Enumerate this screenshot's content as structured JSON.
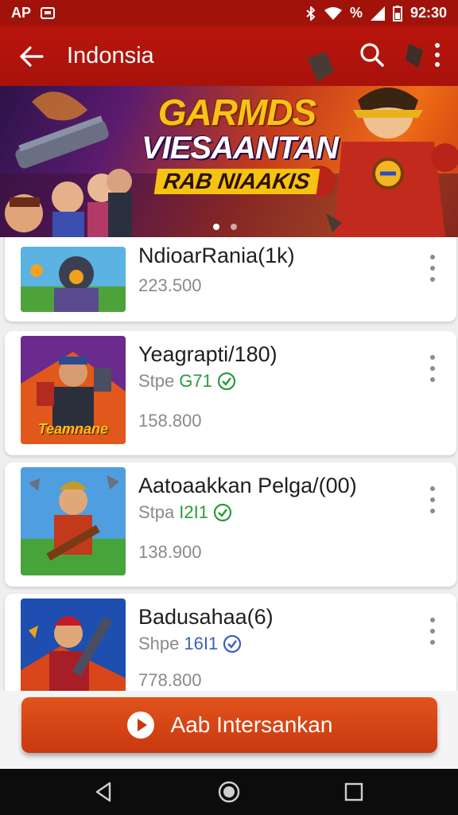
{
  "status": {
    "carrier": "AP",
    "signal_pct": "%",
    "time": "92:30"
  },
  "app_bar": {
    "title": "Indonsia"
  },
  "banner": {
    "line1": "GARMDS",
    "line2": "VIESAANTAN",
    "line3": "RAB NIAAKIS",
    "slide_count": 2,
    "active_slide": 1
  },
  "items": [
    {
      "title": "NdioarRania(1k)",
      "subtitle": "",
      "subtitle_accent": "",
      "price": "223.500"
    },
    {
      "title": "Yeagrapti/180)",
      "subtitle": "Stpe",
      "subtitle_accent": "G71",
      "price": "158.800",
      "thumb_label": "Teamnane"
    },
    {
      "title": "Aatoaakkan Pelga/(00)",
      "subtitle": "Stpa",
      "subtitle_accent": "I2I1",
      "price": "138.900"
    },
    {
      "title": "Badusahaa(6)",
      "subtitle": "Shpe",
      "subtitle_accent": "16I1",
      "price": "778.800"
    }
  ],
  "cta": {
    "label": "Aab Intersankan"
  },
  "colors": {
    "primary": "#a8120b",
    "cta": "#d0421a",
    "check_green": "#2a9a3d",
    "check_blue": "#3a5fc2"
  },
  "icons": [
    "back-arrow-icon",
    "search-icon",
    "more-vert-icon",
    "check-badge-icon",
    "play-icon",
    "nav-back-icon",
    "nav-home-icon",
    "nav-recents-icon"
  ]
}
